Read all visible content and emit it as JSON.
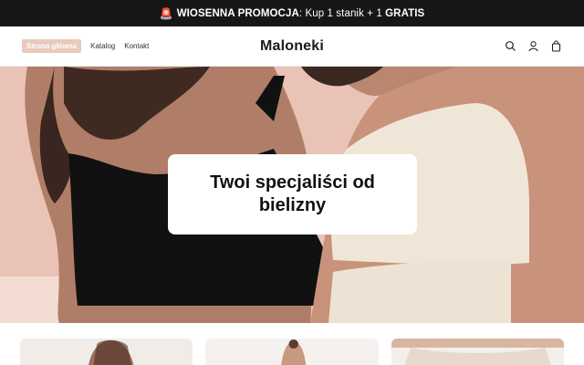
{
  "announcement": {
    "siren_icon": "siren-icon",
    "bold_prefix": "WIOSENNA PROMOCJA",
    "text": ": Kup 1 stanik + 1 ",
    "bold_suffix": "GRATIS"
  },
  "header": {
    "logo": "Maloneki",
    "nav": [
      {
        "label": "Strona główna",
        "active": true
      },
      {
        "label": "Katalog",
        "active": false
      },
      {
        "label": "Kontakt",
        "active": false
      }
    ],
    "icons": [
      "search-icon",
      "account-icon",
      "cart-icon"
    ]
  },
  "hero": {
    "title": "Twoi specjaliści od bielizny"
  },
  "colors": {
    "announcement_bg": "#161616",
    "accent": "#e8c9bc",
    "hero_bg": "#e9c3b5"
  }
}
